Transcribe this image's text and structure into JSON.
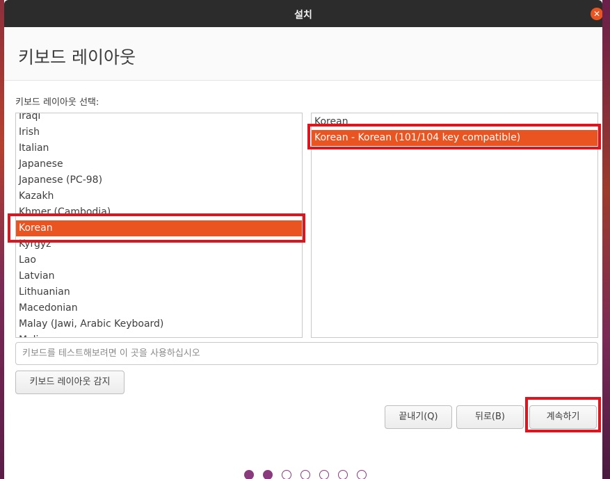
{
  "window": {
    "title": "설치",
    "close_icon": "close-icon"
  },
  "header": {
    "title": "키보드 레이아웃"
  },
  "layout_label": "키보드 레이아웃 선택:",
  "layouts": {
    "items": [
      "Iraqi",
      "Irish",
      "Italian",
      "Japanese",
      "Japanese (PC-98)",
      "Kazakh",
      "Khmer (Cambodia)",
      "Korean",
      "Kyrgyz",
      "Lao",
      "Latvian",
      "Lithuanian",
      "Macedonian",
      "Malay (Jawi, Arabic Keyboard)",
      "Mali"
    ],
    "selected": "Korean"
  },
  "variants": {
    "items": [
      "Korean",
      "Korean - Korean (101/104 key compatible)"
    ],
    "selected": "Korean - Korean (101/104 key compatible)"
  },
  "test_input": {
    "placeholder": "키보드를 테스트해보려면 이 곳을 사용하십시오",
    "value": ""
  },
  "buttons": {
    "detect": "키보드 레이아웃 감지",
    "quit": "끝내기(Q)",
    "back": "뒤로(B)",
    "continue": "계속하기"
  },
  "progress": {
    "total_steps": 7,
    "completed_steps": 2
  },
  "colors": {
    "accent": "#e95420",
    "highlight_box": "#e0141c",
    "progress_dot": "#8a3b7d",
    "titlebar": "#2c2c2c"
  }
}
